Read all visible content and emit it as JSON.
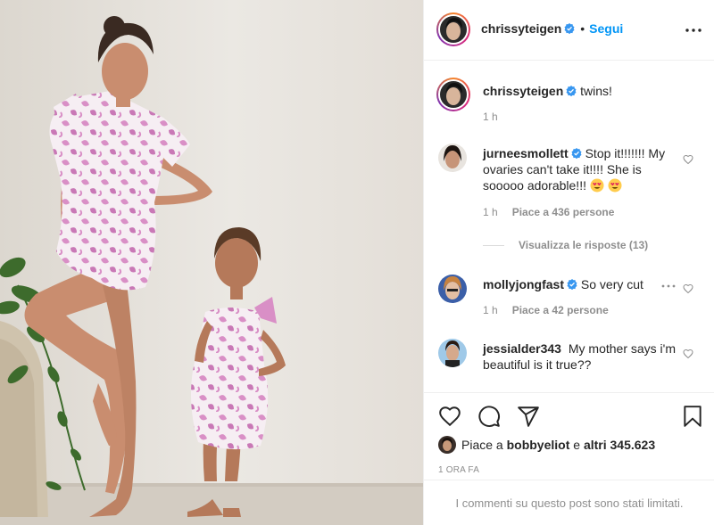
{
  "post": {
    "author": "chrissyteigen",
    "follow_label": "Segui",
    "dot": "•",
    "caption_author": "chrissyteigen",
    "caption": "twins!",
    "caption_time": "1 h"
  },
  "comments": [
    {
      "username": "jurneesmollett",
      "text": "Stop it!!!!!!! My ovaries can't take it!!!! She is sooooo adorable!!!",
      "time": "1 h",
      "likes": "Piace a 436 persone",
      "replies": "Visualizza le risposte (13)"
    },
    {
      "username": "mollyjongfast",
      "text": "So very cut",
      "time": "1 h",
      "likes": "Piace a 42 persone"
    },
    {
      "username": "jessialder343",
      "text": "My mother says i'm beautiful is it true??"
    }
  ],
  "likes": {
    "prefix": "Piace a",
    "user": "bobbyeliot",
    "joiner": "e",
    "others": "altri 345.623"
  },
  "timestamp": "1 ORA FA",
  "comments_limited": "I commenti su questo post sono stati limitati.",
  "colors": {
    "accent": "#0095f6",
    "verified": "#3897f0",
    "muted": "#8e8e8e",
    "dress_pink": "#d98fc6"
  },
  "icons": [
    "more-icon",
    "verified-icon",
    "heart-icon",
    "comment-icon",
    "share-icon",
    "bookmark-icon"
  ]
}
